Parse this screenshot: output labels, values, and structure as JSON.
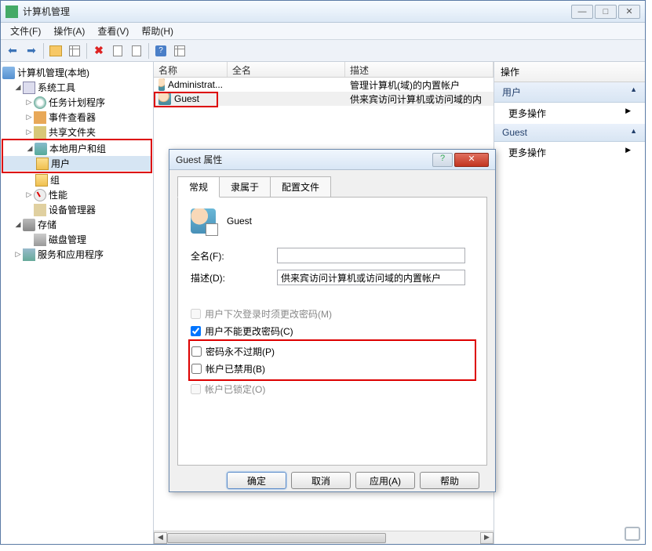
{
  "window": {
    "title": "计算机管理"
  },
  "menu": {
    "file": "文件(F)",
    "action": "操作(A)",
    "view": "查看(V)",
    "help": "帮助(H)"
  },
  "tree": {
    "root": "计算机管理(本地)",
    "system_tools": "系统工具",
    "task_scheduler": "任务计划程序",
    "event_viewer": "事件查看器",
    "shared_folders": "共享文件夹",
    "local_users_groups": "本地用户和组",
    "users": "用户",
    "groups": "组",
    "performance": "性能",
    "device_manager": "设备管理器",
    "storage": "存储",
    "disk_mgmt": "磁盘管理",
    "services_apps": "服务和应用程序"
  },
  "list": {
    "col_name": "名称",
    "col_fullname": "全名",
    "col_desc": "描述",
    "rows": [
      {
        "name": "Administrat...",
        "fullname": "",
        "desc": "管理计算机(域)的内置帐户"
      },
      {
        "name": "Guest",
        "fullname": "",
        "desc": "供来宾访问计算机或访问域的内"
      }
    ]
  },
  "actions": {
    "header": "操作",
    "section1": "用户",
    "more1": "更多操作",
    "section2": "Guest",
    "more2": "更多操作"
  },
  "dialog": {
    "title": "Guest 属性",
    "tab_general": "常规",
    "tab_memberof": "隶属于",
    "tab_profile": "配置文件",
    "username": "Guest",
    "fullname_label": "全名(F):",
    "fullname_value": "",
    "desc_label": "描述(D):",
    "desc_value": "供来宾访问计算机或访问域的内置帐户",
    "chk_mustchange": "用户下次登录时须更改密码(M)",
    "chk_cannotchange": "用户不能更改密码(C)",
    "chk_neverexpire": "密码永不过期(P)",
    "chk_disabled": "帐户已禁用(B)",
    "chk_locked": "帐户已锁定(O)",
    "btn_ok": "确定",
    "btn_cancel": "取消",
    "btn_apply": "应用(A)",
    "btn_help": "帮助"
  },
  "state": {
    "chk_mustchange": false,
    "chk_cannotchange": true,
    "chk_neverexpire": false,
    "chk_disabled": false,
    "chk_locked": false
  }
}
